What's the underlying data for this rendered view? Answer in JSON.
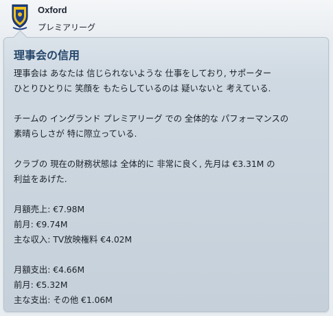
{
  "header": {
    "club_name": "Oxford",
    "league": "プレミアリーグ",
    "crest_icon": "club-crest-icon"
  },
  "panel": {
    "title": "理事会の信用",
    "lines": [
      "理事会は あなたは 信じられないような 仕事をしており, サポーター",
      "ひとりひとりに 笑顔を もたらしているのは 疑いないと 考えている.",
      "",
      "チームの イングランド プレミアリーグ での 全体的な パフォーマンスの",
      "素晴らしさが 特に際立っている.",
      "",
      "クラブの 現在の財務状態は 全体的に 非常に良く, 先月は €3.31M の",
      "利益をあげた.",
      "",
      "月額売上: €7.98M",
      "前月: €9.74M",
      "主な収入: TV放映権料 €4.02M",
      "",
      "月額支出: €4.66M",
      "前月: €5.32M",
      "主な支出: その他 €1.06M"
    ]
  },
  "colors": {
    "title": "#24466b",
    "panel_bg": "#cfd9e2",
    "crest_blue": "#1f3f86",
    "crest_yellow": "#f2c21b"
  }
}
